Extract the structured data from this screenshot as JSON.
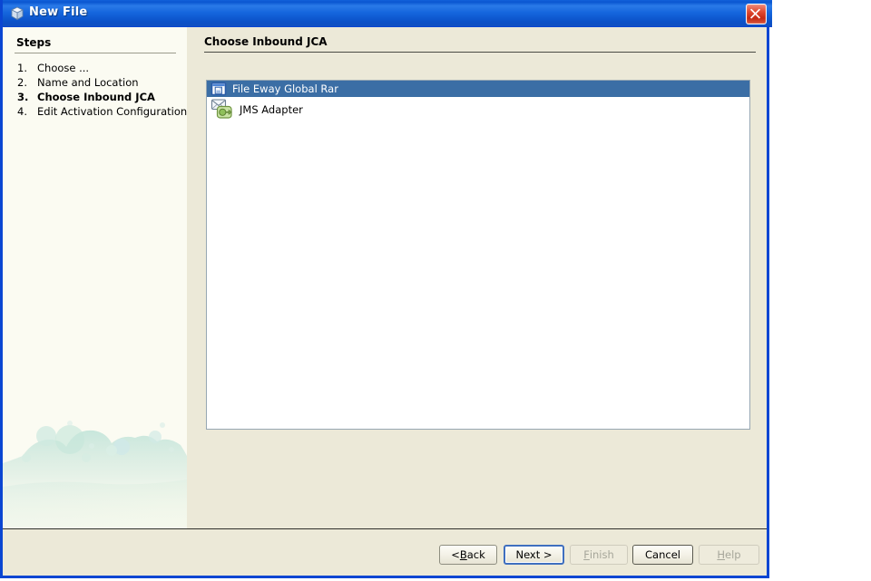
{
  "window": {
    "title": "New File",
    "title_icon": "cube-icon",
    "close_icon": "close-icon"
  },
  "sidebar": {
    "heading": "Steps",
    "steps": [
      {
        "num": "1.",
        "label": "Choose ...",
        "current": false
      },
      {
        "num": "2.",
        "label": "Name and Location",
        "current": false
      },
      {
        "num": "3.",
        "label": "Choose Inbound JCA",
        "current": true
      },
      {
        "num": "4.",
        "label": "Edit Activation Configuration",
        "current": false
      }
    ],
    "artwork": "bubbles-decoration"
  },
  "content": {
    "pane_title": "Choose Inbound JCA",
    "list": {
      "items": [
        {
          "label": "File Eway Global Rar",
          "icon": "document-window-icon",
          "selected": true
        },
        {
          "label": "JMS Adapter",
          "icon": "jms-adapter-icon",
          "selected": false
        }
      ]
    }
  },
  "buttons": {
    "back": {
      "label_pre": "< ",
      "mnemonic": "B",
      "label_post": "ack",
      "disabled": false,
      "focused": false
    },
    "next": {
      "label_pre": "",
      "mnemonic": "N",
      "label_post": "ext >",
      "disabled": false,
      "focused": true
    },
    "finish": {
      "label_pre": "",
      "mnemonic": "F",
      "label_post": "inish",
      "disabled": true,
      "focused": false
    },
    "cancel": {
      "label_pre": "",
      "mnemonic": "C",
      "label_post": "ancel",
      "disabled": false,
      "focused": false
    },
    "help": {
      "label_pre": "",
      "mnemonic": "H",
      "label_post": "elp",
      "disabled": true,
      "focused": false
    }
  },
  "colors": {
    "titlebar_blue": "#1566dd",
    "window_border": "#0a46d2",
    "dialog_face": "#ece9d8",
    "sidebar_face": "#fbfbf2",
    "selection_blue": "#3b6ea5",
    "close_red": "#c52a14"
  }
}
